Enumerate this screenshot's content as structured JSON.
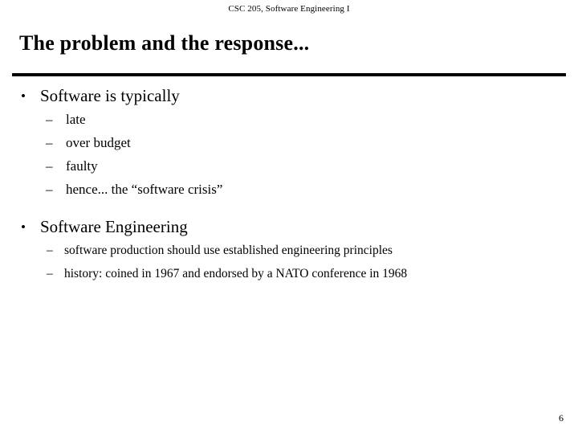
{
  "slide": {
    "header": "CSC 205, Software Engineering I",
    "title": "The problem and the response...",
    "page_number": "6",
    "markers": {
      "level1": "•",
      "level2": "–"
    },
    "groups": [
      {
        "heading": "Software is typically",
        "items": [
          "late",
          "over budget",
          "faulty",
          "hence... the “software crisis”"
        ]
      },
      {
        "heading": "Software Engineering",
        "items": [
          "software production should use established engineering principles",
          "history: coined in 1967 and endorsed by a NATO conference in 1968"
        ]
      }
    ]
  },
  "colors": {
    "text": "#000000",
    "background": "#ffffff",
    "rule": "#000000"
  }
}
